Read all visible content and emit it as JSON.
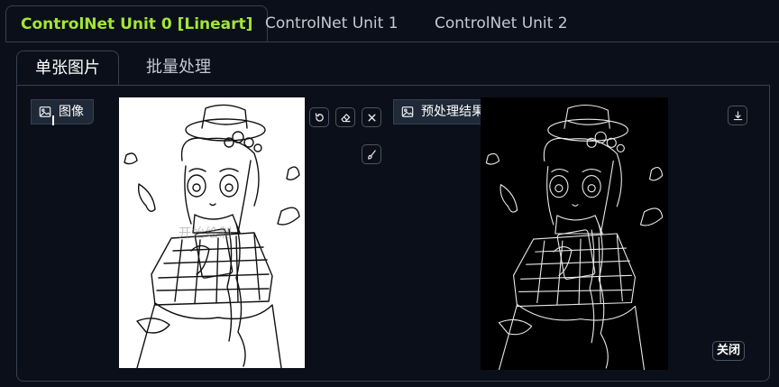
{
  "unit_tabs": [
    {
      "label": "ControlNet Unit 0 [Lineart]"
    },
    {
      "label": "ControlNet Unit 1"
    },
    {
      "label": "ControlNet Unit 2"
    }
  ],
  "sub_tabs": [
    {
      "label": "单张图片"
    },
    {
      "label": "批量处理"
    }
  ],
  "image_input": {
    "label": "图像",
    "icon": "image-icon",
    "watermark": "开始绘制"
  },
  "preview": {
    "label": "预处理结果预览",
    "icon": "image-icon",
    "close_label": "关闭"
  },
  "toolbar_icons": [
    "undo-icon",
    "eraser-icon",
    "close-icon",
    "brush-icon",
    "download-icon"
  ],
  "colors": {
    "background": "#0b0f19",
    "active_unit_tab": "#a3e635",
    "border": "#374151"
  }
}
